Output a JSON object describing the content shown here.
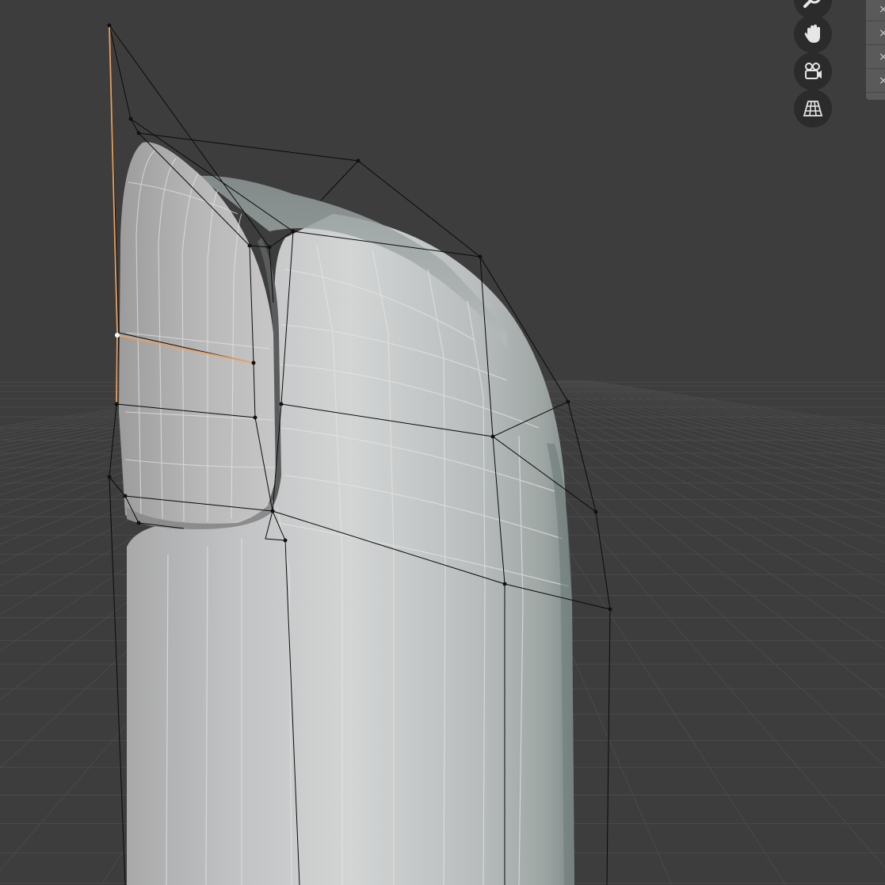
{
  "viewport": {
    "navigation_gizmo": {
      "buttons": [
        {
          "name": "zoom",
          "icon": "magnifier-icon"
        },
        {
          "name": "pan",
          "icon": "hand-icon"
        },
        {
          "name": "camera",
          "icon": "camera-icon"
        },
        {
          "name": "orthographic",
          "icon": "grid-perspective-icon"
        }
      ]
    },
    "side_tabs": [
      "×",
      "×",
      "×",
      "×"
    ],
    "colors": {
      "background": "#3d3d3d",
      "mesh": "#c8cacb",
      "selected_edge": "#e8a060",
      "cage": "#0a0a0a",
      "button": "#2b2b2b"
    }
  }
}
